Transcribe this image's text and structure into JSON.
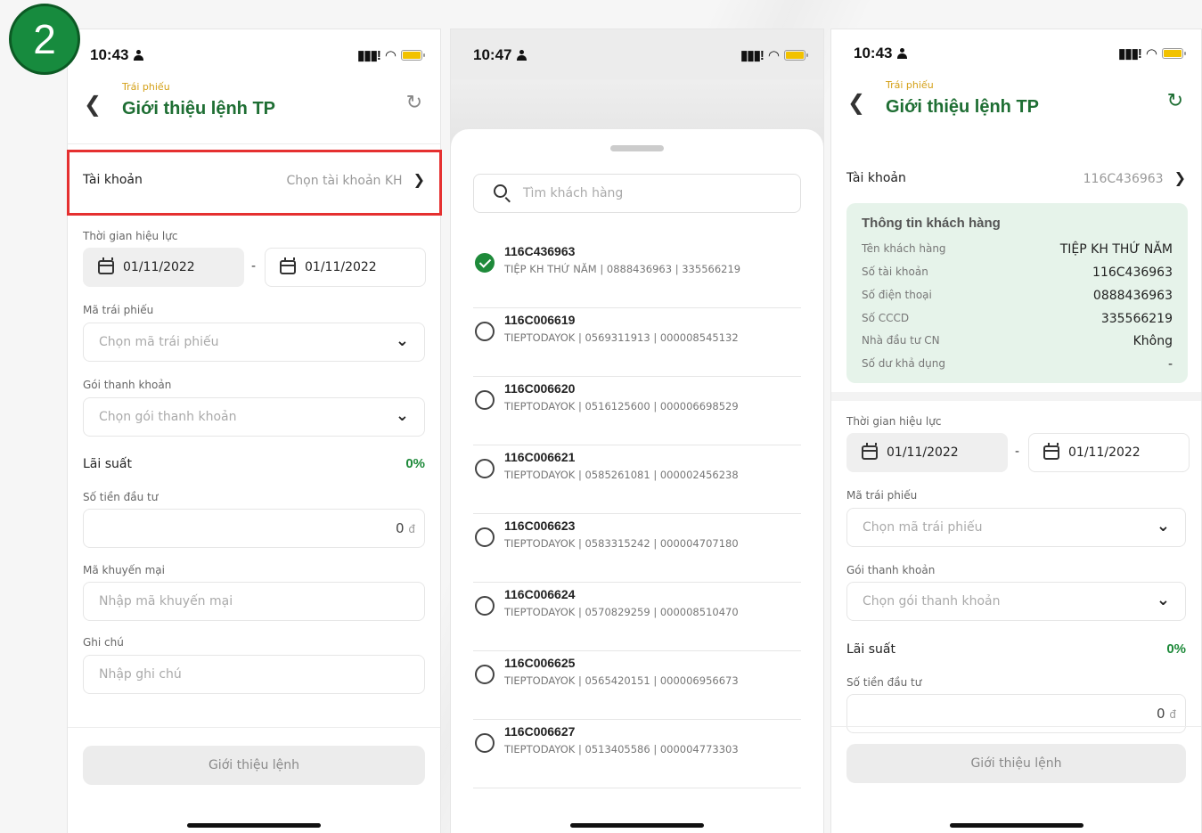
{
  "step_number": "2",
  "status_times": {
    "p1": "10:43",
    "p2": "10:47",
    "p3": "10:43"
  },
  "icons": {
    "signal": "signal-icon",
    "wifi": "wifi-icon",
    "battery": "battery-icon",
    "back": "chevron-left-icon",
    "refresh": "refresh-icon",
    "calendar": "calendar-icon",
    "chevron_down": "chevron-down-icon",
    "chevron_right": "chevron-right-icon",
    "search": "search-icon",
    "check": "check-icon"
  },
  "colors": {
    "brand_green": "#1e6e33",
    "accent_yellow": "#d4a017",
    "highlight_red": "#e53030",
    "card_bg": "#e6f3ea"
  },
  "form": {
    "breadcrumb": "Trái phiếu",
    "title": "Giới thiệu lệnh TP",
    "account_label": "Tài khoản",
    "account_placeholder": "Chọn tài khoản KH",
    "validity_label": "Thời gian hiệu lực",
    "date_from": "01/11/2022",
    "date_to": "01/11/2022",
    "date_sep": "-",
    "bond_code_label": "Mã trái phiếu",
    "bond_code_placeholder": "Chọn mã trái phiếu",
    "package_label": "Gói thanh khoản",
    "package_placeholder": "Chọn gói thanh khoản",
    "interest_label": "Lãi suất",
    "interest_value": "0%",
    "amount_label": "Số tiền đầu tư",
    "amount_value": "0",
    "amount_unit": "đ",
    "promo_label": "Mã khuyến mại",
    "promo_placeholder": "Nhập mã khuyến mại",
    "note_label": "Ghi chú",
    "note_placeholder": "Nhập ghi chú",
    "submit_label": "Giới thiệu lệnh"
  },
  "picker": {
    "search_placeholder": "Tìm khách hàng",
    "customers": [
      {
        "id": "116C436963",
        "info": "TIỆP KH THỨ NĂM | 0888436963 | 335566219",
        "selected": true
      },
      {
        "id": "116C006619",
        "info": "TIEPTODAYOK | 0569311913 | 000008545132",
        "selected": false
      },
      {
        "id": "116C006620",
        "info": "TIEPTODAYOK | 0516125600 | 000006698529",
        "selected": false
      },
      {
        "id": "116C006621",
        "info": "TIEPTODAYOK | 0585261081 | 000002456238",
        "selected": false
      },
      {
        "id": "116C006623",
        "info": "TIEPTODAYOK | 0583315242 | 000004707180",
        "selected": false
      },
      {
        "id": "116C006624",
        "info": "TIEPTODAYOK | 0570829259 | 000008510470",
        "selected": false
      },
      {
        "id": "116C006625",
        "info": "TIEPTODAYOK | 0565420151 | 000006956673",
        "selected": false
      },
      {
        "id": "116C006627",
        "info": "TIEPTODAYOK | 0513405586 | 000004773303",
        "selected": false
      }
    ]
  },
  "selected": {
    "account_value": "116C436963",
    "card_title": "Thông tin khách hàng",
    "fields": [
      {
        "k": "Tên khách hàng",
        "v": "TIỆP KH THỨ NĂM"
      },
      {
        "k": "Số tài khoản",
        "v": "116C436963"
      },
      {
        "k": "Số điện thoại",
        "v": "0888436963"
      },
      {
        "k": "Số CCCD",
        "v": "335566219"
      },
      {
        "k": "Nhà đầu tư CN",
        "v": "Không"
      },
      {
        "k": "Số dư khả dụng",
        "v": "-"
      }
    ]
  }
}
